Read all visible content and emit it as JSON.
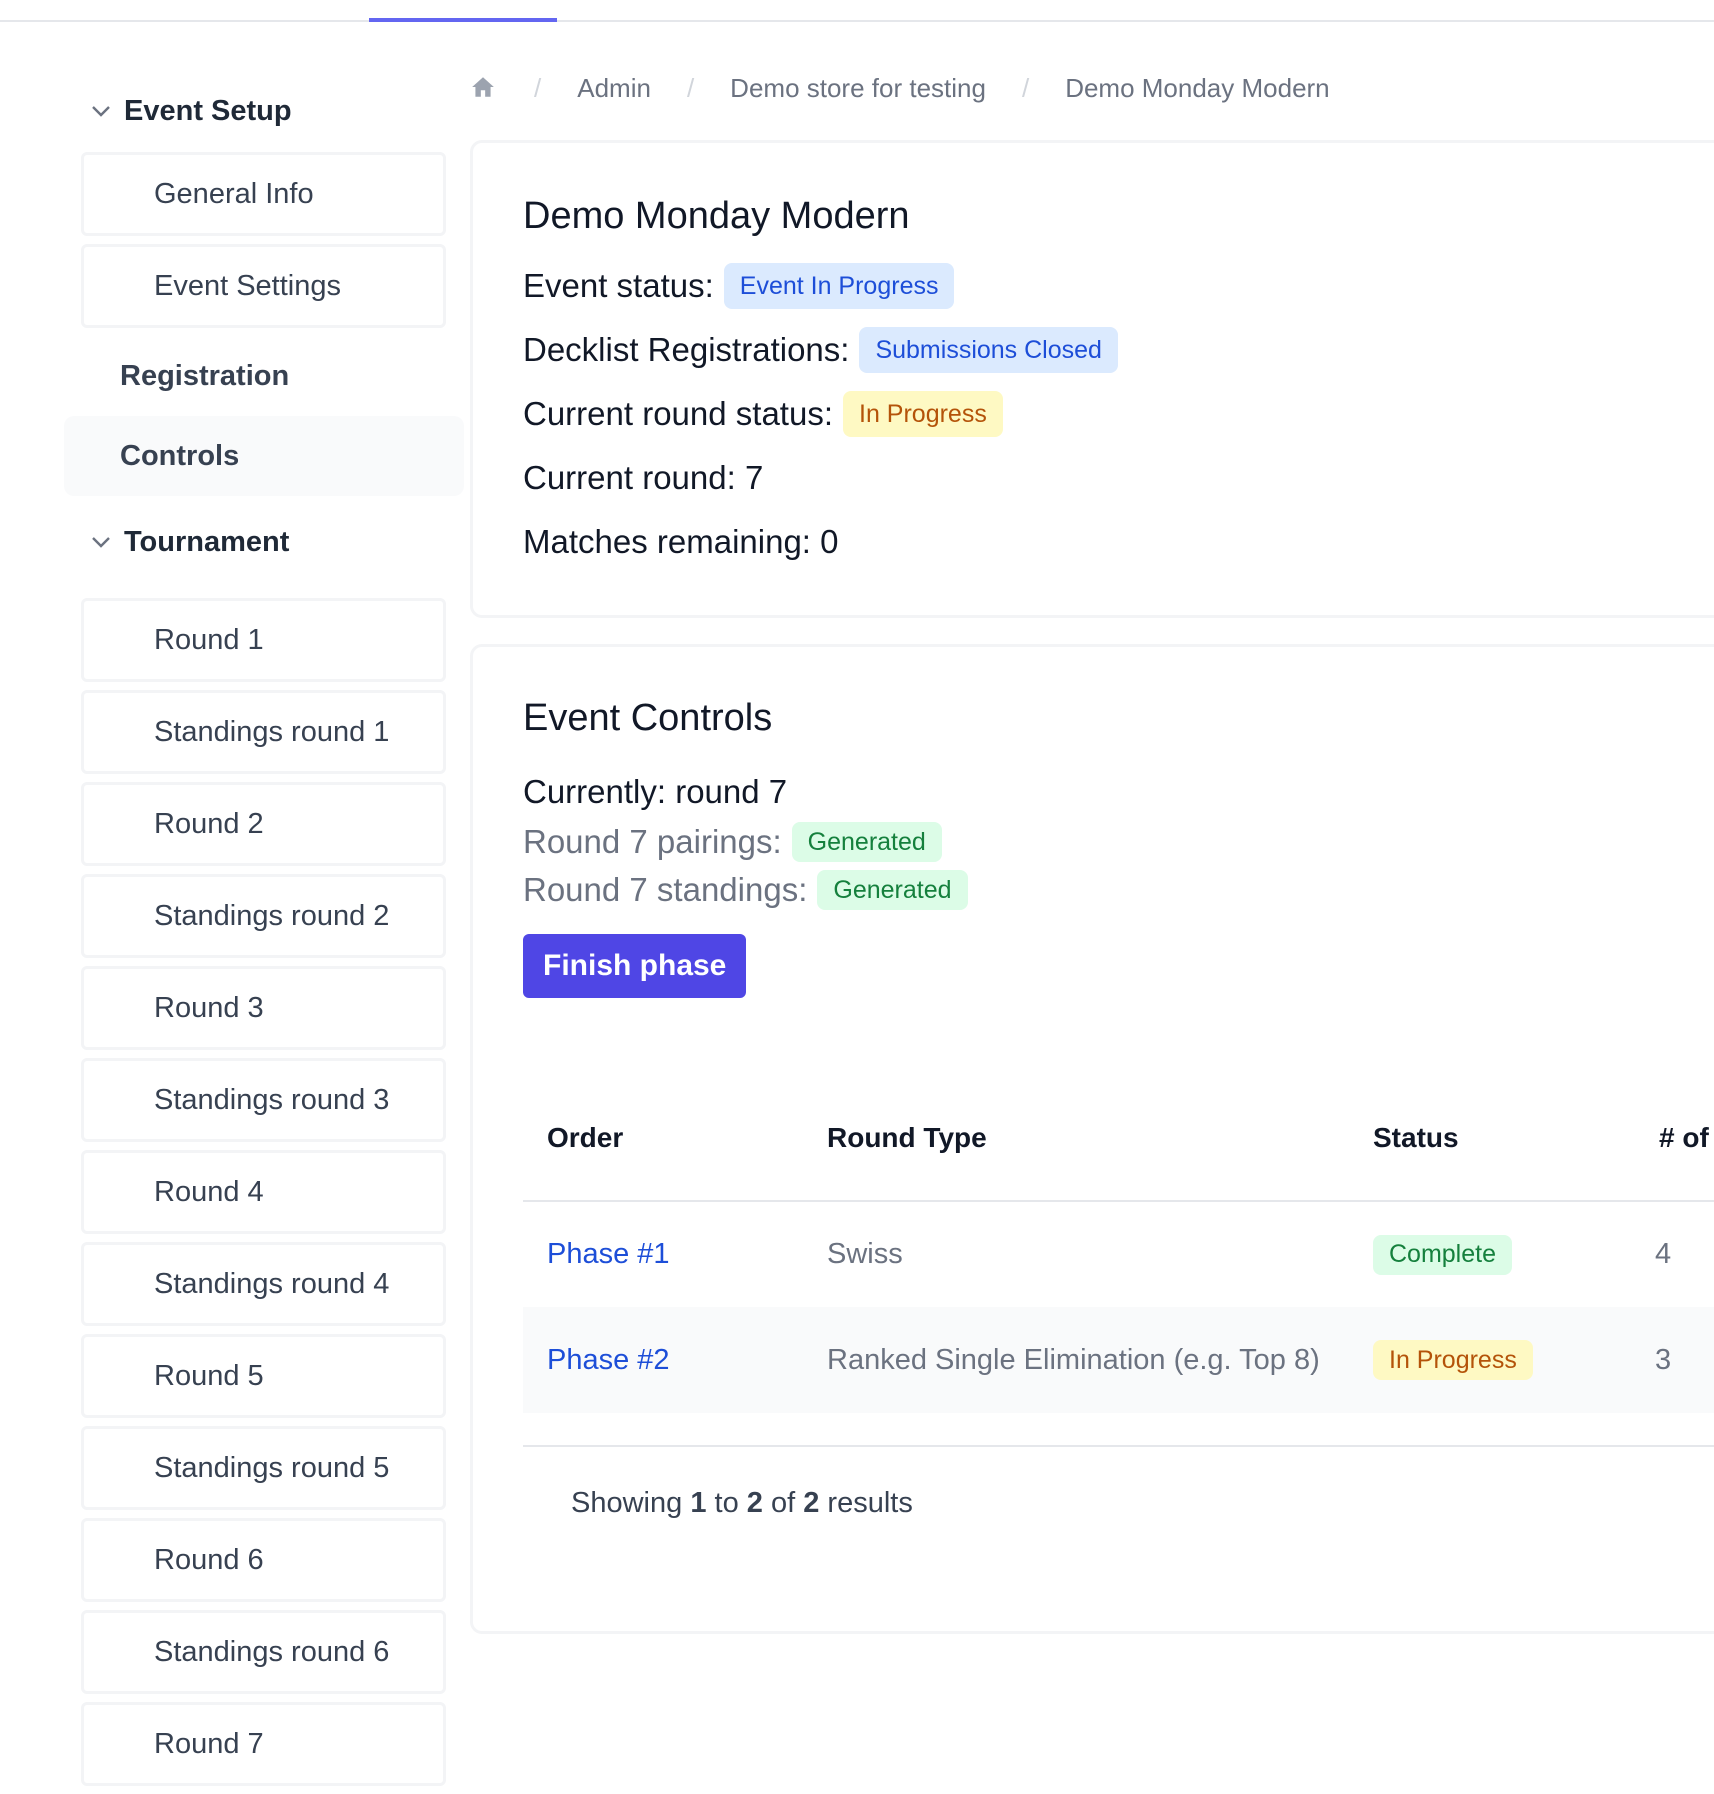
{
  "sidebar": {
    "event_setup": "Event Setup",
    "general_info": "General Info",
    "event_settings": "Event Settings",
    "registration": "Registration",
    "controls": "Controls",
    "tournament": "Tournament",
    "rounds": [
      "Round 1",
      "Standings round 1",
      "Round 2",
      "Standings round 2",
      "Round 3",
      "Standings round 3",
      "Round 4",
      "Standings round 4",
      "Round 5",
      "Standings round 5",
      "Round 6",
      "Standings round 6",
      "Round 7"
    ]
  },
  "breadcrumb": {
    "items": [
      "Admin",
      "Demo store for testing",
      "Demo Monday Modern"
    ],
    "sep": "/"
  },
  "event": {
    "title": "Demo Monday Modern",
    "status_label": "Event status:",
    "status_value": "Event In Progress",
    "decklist_label": "Decklist Registrations:",
    "decklist_value": "Submissions Closed",
    "round_status_label": "Current round status:",
    "round_status_value": "In Progress",
    "current_round": "Current round: 7",
    "matches_remaining": "Matches remaining: 0"
  },
  "controls": {
    "title": "Event Controls",
    "currently": "Currently: round 7",
    "pairings_label": "Round 7 pairings:",
    "pairings_value": "Generated",
    "standings_label": "Round 7 standings:",
    "standings_value": "Generated",
    "finish_button": "Finish phase"
  },
  "table": {
    "headers": [
      "Order",
      "Round Type",
      "Status",
      "# of"
    ],
    "rows": [
      {
        "order": "Phase #1",
        "type": "Swiss",
        "status": "Complete",
        "count": "4"
      },
      {
        "order": "Phase #2",
        "type": "Ranked Single Elimination (e.g. Top 8)",
        "status": "In Progress",
        "count": "3"
      }
    ]
  },
  "pagination": {
    "showing": "Showing",
    "from": "1",
    "to_word": "to",
    "to": "2",
    "of_word": "of",
    "total": "2",
    "results": "results"
  },
  "colors": {
    "accent": "#4f46e5",
    "link": "#1d4ed8",
    "badge_blue": "#dbeafe",
    "badge_yellow": "#fef9c3",
    "badge_green": "#dcfce7"
  },
  "icons": {
    "home": "home-icon",
    "chevron": "chevron-down-icon"
  }
}
